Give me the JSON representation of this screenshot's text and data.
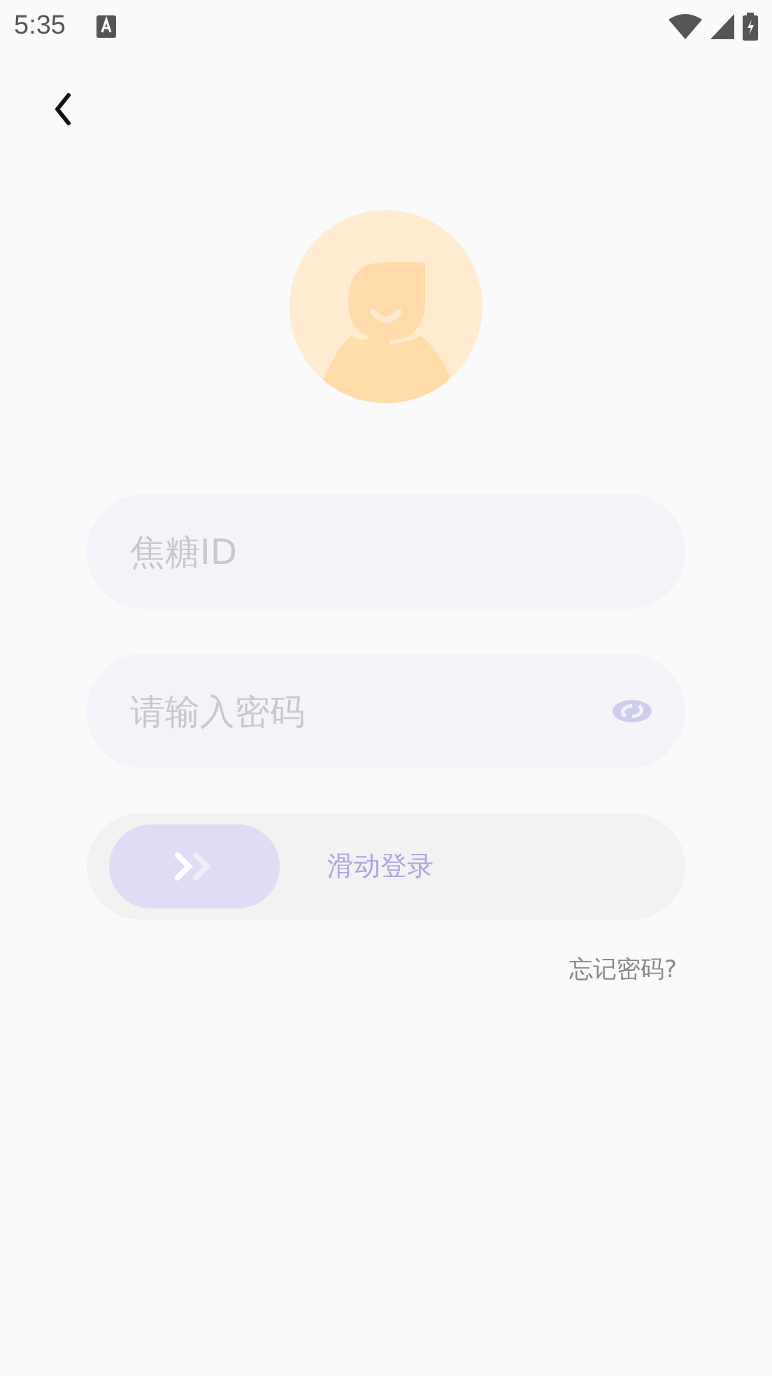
{
  "status_bar": {
    "time": "5:35"
  },
  "account_field": {
    "placeholder": "焦糖ID"
  },
  "password_field": {
    "placeholder": "请输入密码",
    "password_hidden": true
  },
  "slide_login": {
    "label": "滑动登录"
  },
  "forgot_password": "忘记密码?"
}
